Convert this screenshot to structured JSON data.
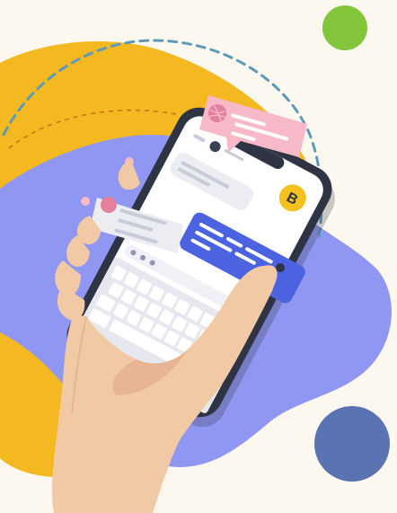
{
  "illustration": {
    "subject": "hand-holding-smartphone-with-chat-app",
    "app_logo_letter": "B"
  },
  "colors": {
    "background": "#fcf8ef",
    "yellow_blob": "#f4b820",
    "periwinkle_blob": "#8f97f2",
    "green_dot": "#82c43a",
    "blue_dot": "#5a73b2",
    "dashed_arc": "#5c9ab8",
    "chat_pink": "#f7b8c8",
    "chat_pink_text": "#e3809c",
    "chat_blue": "#4b63e0",
    "chat_grey": "#ecedf3",
    "logo_yellow": "#f4c21c",
    "skin": "#f2c9a5",
    "skin_shadow": "#dfa988",
    "phone_body": "#2f3445",
    "keyboard": "#e7e8ef"
  },
  "icons": [
    "dribbble-icon",
    "bitcoin-logo-icon",
    "avatar-icon",
    "keyboard-icon"
  ]
}
